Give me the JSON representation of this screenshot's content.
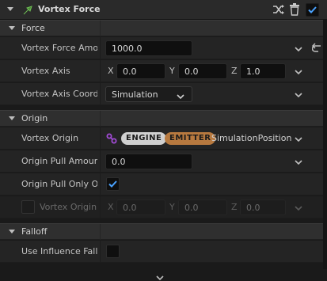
{
  "header": {
    "title": "Vortex Force",
    "icon": "module-arrow-icon",
    "enabled": true,
    "actions": [
      "shuffle-icon",
      "trash-icon"
    ]
  },
  "sections": {
    "force": {
      "label": "Force",
      "rows": {
        "amount": {
          "label": "Vortex Force Amou",
          "value": "1000.0"
        },
        "axis": {
          "label": "Vortex Axis",
          "x_label": "X",
          "x": "0.0",
          "y_label": "Y",
          "y": "0.0",
          "z_label": "Z",
          "z": "1.0"
        },
        "coord": {
          "label": "Vortex Axis Coordi",
          "value": "Simulation"
        }
      }
    },
    "origin": {
      "label": "Origin",
      "rows": {
        "origin": {
          "label": "Vortex Origin",
          "pill_engine": "ENGINE",
          "pill_emitter": "EMITTER",
          "value": "SimulationPosition"
        },
        "pull_amount": {
          "label": "Origin Pull Amount",
          "value": "0.0"
        },
        "pull_only": {
          "label": "Origin Pull Only On",
          "checked": true
        },
        "origin_override": {
          "label": "Vortex Origin (",
          "x_label": "X",
          "x": "0.0",
          "y_label": "Y",
          "y": "0.0",
          "z_label": "Z",
          "z": "0.0",
          "enabled": false
        }
      }
    },
    "falloff": {
      "label": "Falloff",
      "rows": {
        "influence": {
          "label": "Use Influence Fallo",
          "checked": false
        }
      }
    }
  },
  "colors": {
    "accent_check": "#4aa3ff",
    "emitter_pill": "#b7793f",
    "engine_pill": "#d0d0d0",
    "link_icon": "#a24bd6"
  }
}
